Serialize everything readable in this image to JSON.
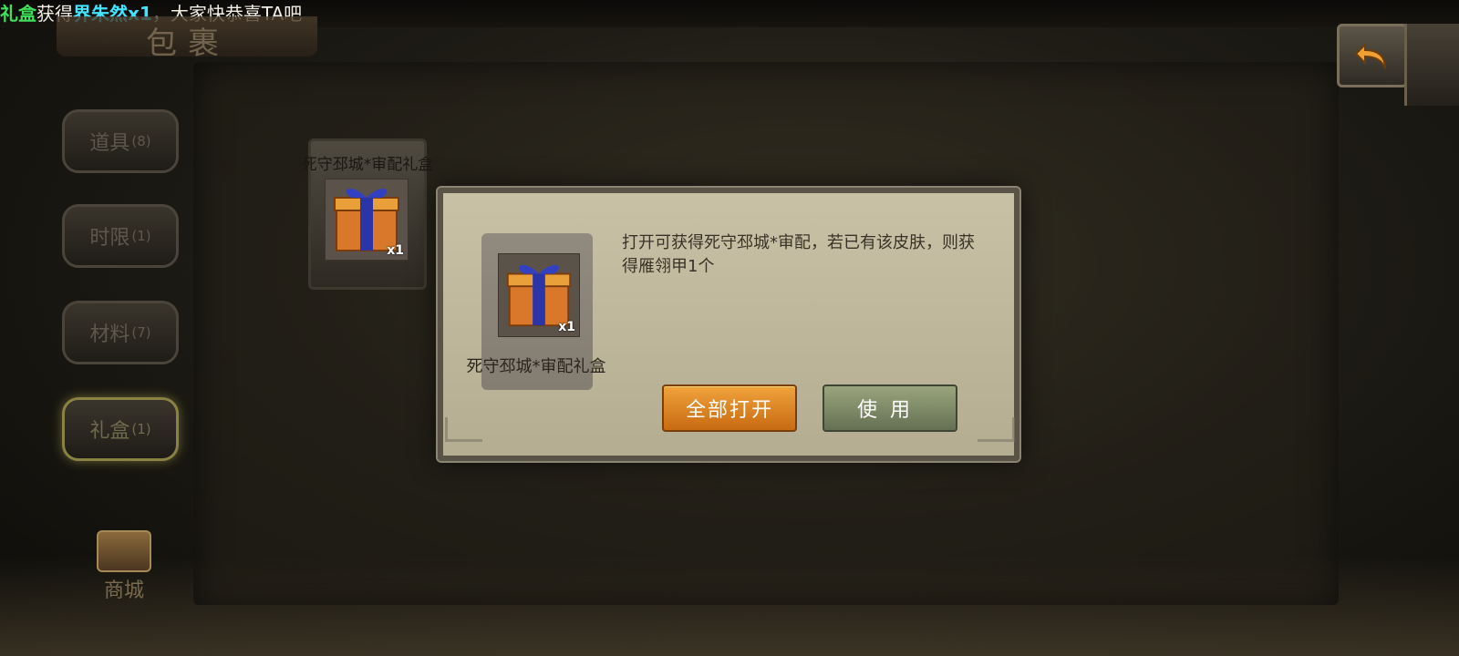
{
  "broadcast": {
    "seg1": "礼盒",
    "seg2": "获得",
    "seg3": "界朱然x1",
    "seg4": "，大家快恭喜TA吧"
  },
  "title": "包裹",
  "tabs": [
    {
      "label": "道具",
      "count": "(8)"
    },
    {
      "label": "时限",
      "count": "(1)"
    },
    {
      "label": "材料",
      "count": "(7)"
    },
    {
      "label": "礼盒",
      "count": "(1)"
    }
  ],
  "shop_label": "商城",
  "grid_item": {
    "name": "死守邳城*审配礼盒",
    "qty": "x1"
  },
  "modal": {
    "item_name": "死守邳城*审配礼盒",
    "qty": "x1",
    "description": "打开可获得死守邳城*审配，若已有该皮肤，则获得雁翎甲1个",
    "open_all_label": "全部打开",
    "use_label": "使用"
  },
  "icons": {
    "back": "back-arrow-icon",
    "gift": "gift-box-icon",
    "shop": "treasure-chest-icon"
  }
}
